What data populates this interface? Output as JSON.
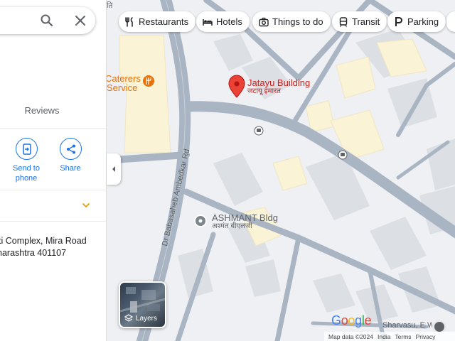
{
  "search": {
    "search_icon": "search-icon",
    "close_icon": "close-icon"
  },
  "panel": {
    "tab_reviews": "Reviews",
    "actions": [
      {
        "label_line1": "Send to",
        "label_line2": "phone",
        "icon": "send-to-phone-icon"
      },
      {
        "label_line1": "Share",
        "label_line2": "",
        "icon": "share-icon"
      }
    ],
    "address_line1": "ti Complex, Mira Road",
    "address_line2": "harashtra 401107"
  },
  "chips": [
    {
      "label": "Restaurants",
      "icon": "fork-knife-icon"
    },
    {
      "label": "Hotels",
      "icon": "bed-icon"
    },
    {
      "label": "Things to do",
      "icon": "camera-icon"
    },
    {
      "label": "Transit",
      "icon": "train-icon"
    },
    {
      "label": "Parking",
      "icon": "parking-icon"
    }
  ],
  "map": {
    "place_marker": {
      "name": "Jatayu Building",
      "subname": "जटायू इमारत",
      "color": "#ea4335"
    },
    "poi_ashmant": {
      "name": "ASHMANT Bldg",
      "subname": "अश्मंत बीएलजी"
    },
    "poi_caterers": {
      "line1": "Caterers",
      "line2": "Service"
    },
    "road_label": "Dr Babasaheb Ambedkar Rd",
    "bottom_label": "Sharvasu, E Wing",
    "top_fragment": "ति"
  },
  "layers": {
    "label": "Layers"
  },
  "logo": "Google",
  "footer": {
    "map_data": "Map data ©2024",
    "india": "India",
    "terms": "Terms",
    "privacy": "Privacy"
  },
  "colors": {
    "accent": "#1a73e8",
    "marker": "#ea4335",
    "road": "#aab5c4",
    "building": "#dcdfe3",
    "highlight": "#fbf3d5"
  }
}
